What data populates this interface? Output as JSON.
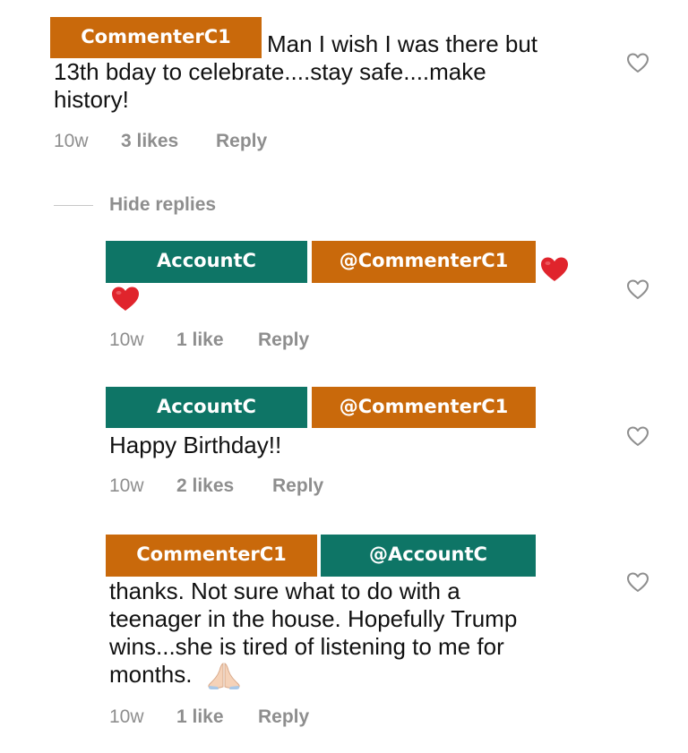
{
  "comment": {
    "author": "CommenterC1",
    "text_line1": "Man I wish I was there but",
    "text_line2": "13th bday to celebrate....stay safe....make",
    "text_line3": "history!",
    "time": "10w",
    "likes": "3 likes",
    "reply": "Reply"
  },
  "hide_replies": "Hide replies",
  "replies": [
    {
      "author": "AccountC",
      "mention": "@CommenterC1",
      "time": "10w",
      "likes": "1 like",
      "reply": "Reply"
    },
    {
      "author": "AccountC",
      "mention": "@CommenterC1",
      "text": "Happy Birthday!!",
      "time": "10w",
      "likes": "2 likes",
      "reply": "Reply"
    },
    {
      "author": "CommenterC1",
      "mention": "@AccountC",
      "text_line1": "thanks. Not sure what to do with a",
      "text_line2": "teenager in the house.  Hopefully Trump",
      "text_line3": "wins...she is tired of listening to me for",
      "text_line4": "months.",
      "time": "10w",
      "likes": "1 like",
      "reply": "Reply"
    }
  ],
  "icons": {
    "like": "heart-outline-icon",
    "red_heart": "red-heart-emoji",
    "praying_hands": "praying-hands-emoji"
  },
  "colors": {
    "orange_tag": "#c9690b",
    "teal_tag": "#0e7566",
    "meta_gray": "#8e8e8e",
    "heart_red": "#e0242c"
  }
}
